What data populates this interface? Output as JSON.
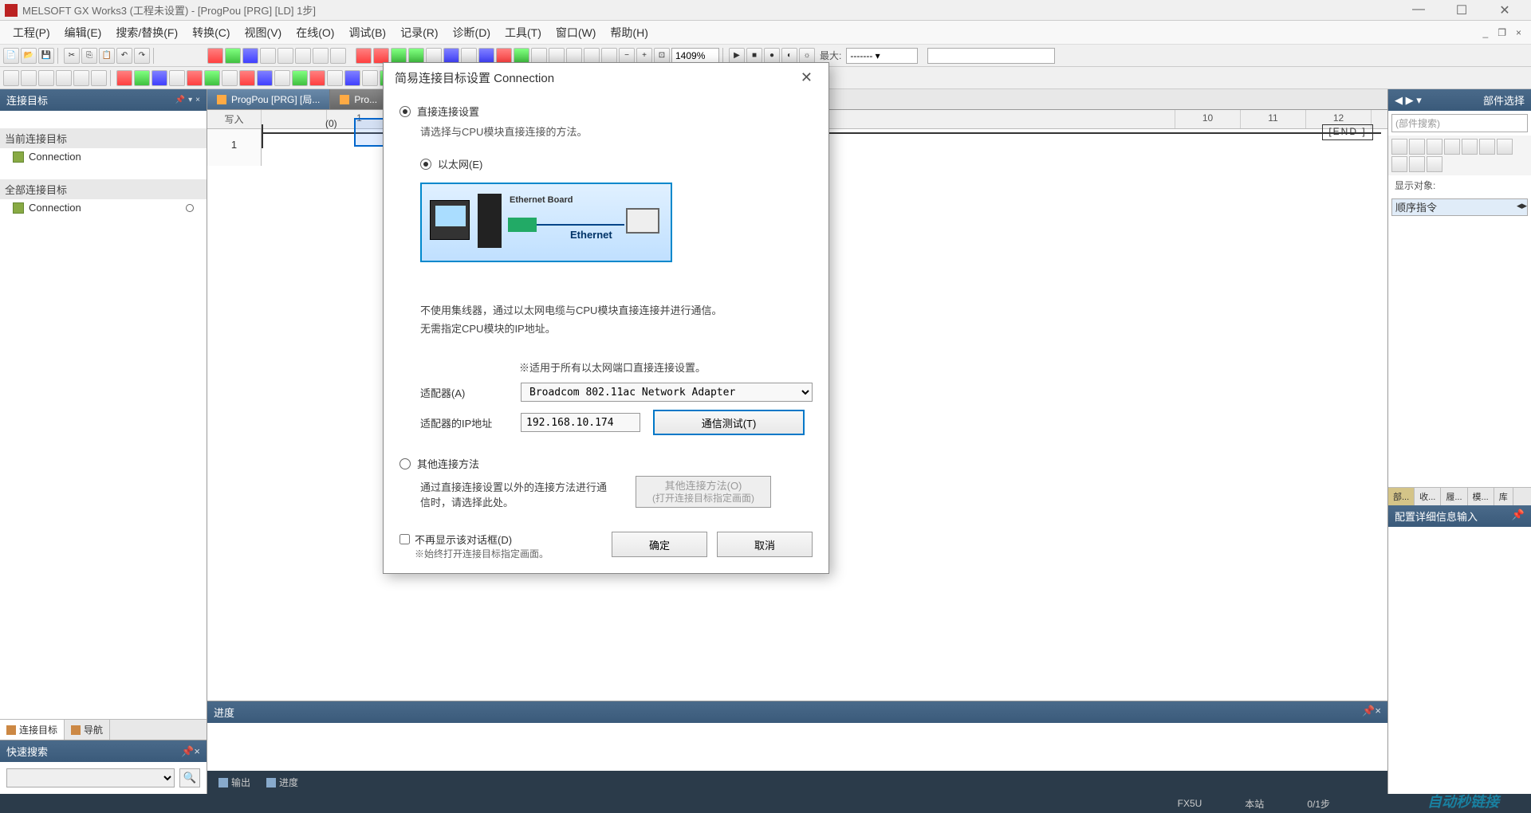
{
  "titlebar": {
    "app_name": "MELSOFT GX Works3",
    "project_state": "(工程未设置)",
    "doc": "[ProgPou [PRG] [LD] 1步]"
  },
  "menus": [
    "工程(P)",
    "编辑(E)",
    "搜索/替换(F)",
    "转换(C)",
    "视图(V)",
    "在线(O)",
    "调试(B)",
    "记录(R)",
    "诊断(D)",
    "工具(T)",
    "窗口(W)",
    "帮助(H)"
  ],
  "toolbar": {
    "zoom": "1409%",
    "max_label": "最大:",
    "max_value": "------- ▾"
  },
  "left": {
    "title": "连接目标",
    "section_current": "当前连接目标",
    "section_all": "全部连接目标",
    "item_connection": "Connection",
    "tab_connection": "连接目标",
    "tab_nav": "导航"
  },
  "quick_search": {
    "title": "快速搜索"
  },
  "doc_tabs": {
    "tab1": "ProgPou [PRG] [局...",
    "tab2": "Pro..."
  },
  "ladder": {
    "write_label": "写入",
    "columns": [
      "1",
      "10",
      "11",
      "12"
    ],
    "row": "1",
    "step": "(0)",
    "end": "[END   ]"
  },
  "right": {
    "title": "部件选择",
    "search_placeholder": "(部件搜索)",
    "display_label": "显示对象:",
    "display_value": "顺序指令",
    "tabs": [
      "部...",
      "收...",
      "履...",
      "模...",
      "库"
    ],
    "detail_title": "配置详细信息输入"
  },
  "progress": {
    "title": "进度",
    "output_tab": "输出",
    "progress_tab": "进度"
  },
  "statusbar": {
    "cpu": "FX5U",
    "station": "本站",
    "steps": "0/1步",
    "watermark": "自动秒链接"
  },
  "dialog": {
    "title": "简易连接目标设置 Connection",
    "radio_direct": "直接连接设置",
    "hint_direct": "请选择与CPU模块直接连接的方法。",
    "radio_ethernet": "以太网(E)",
    "diagram": {
      "board": "Ethernet Board",
      "eth": "Ethernet"
    },
    "desc1": "不使用集线器，通过以太网电缆与CPU模块直接连接并进行通信。",
    "desc2": "无需指定CPU模块的IP地址。",
    "applies": "※适用于所有以太网端口直接连接设置。",
    "adapter_label": "适配器(A)",
    "adapter_value": "Broadcom 802.11ac Network Adapter",
    "ip_label": "适配器的IP地址",
    "ip_value": "192.168.10.174",
    "btn_test": "通信测试(T)",
    "radio_other": "其他连接方法",
    "other_desc": "通过直接连接设置以外的连接方法进行通信时，请选择此处。",
    "btn_other": "其他连接方法(O)",
    "btn_other_sub": "(打开连接目标指定画面)",
    "check_noshow": "不再显示该对话框(D)",
    "check_sub": "※始终打开连接目标指定画面。",
    "btn_ok": "确定",
    "btn_cancel": "取消"
  }
}
